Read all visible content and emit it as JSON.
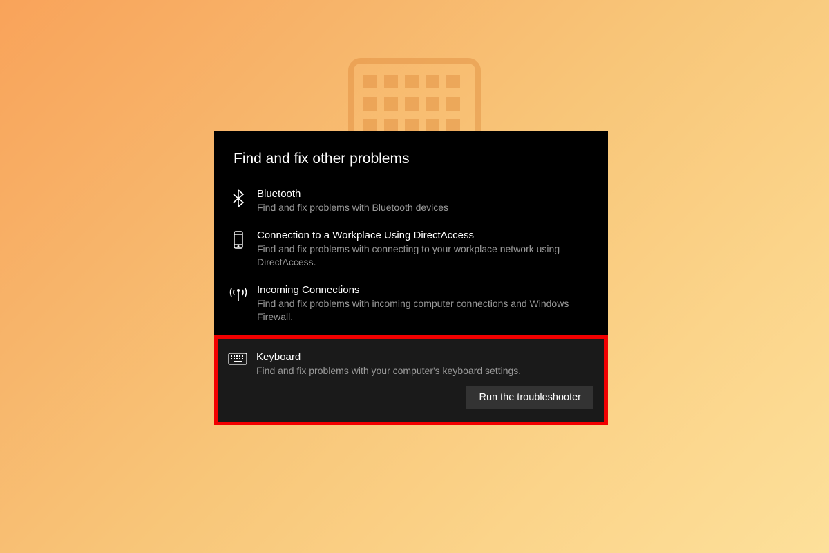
{
  "panel": {
    "title": "Find and fix other problems"
  },
  "items": [
    {
      "title": "Bluetooth",
      "desc": "Find and fix problems with Bluetooth devices"
    },
    {
      "title": "Connection to a Workplace Using DirectAccess",
      "desc": "Find and fix problems with connecting to your workplace network using DirectAccess."
    },
    {
      "title": "Incoming Connections",
      "desc": "Find and fix problems with incoming computer connections and Windows Firewall."
    },
    {
      "title": "Keyboard",
      "desc": "Find and fix problems with your computer's keyboard settings."
    }
  ],
  "button": {
    "run": "Run the troubleshooter"
  }
}
